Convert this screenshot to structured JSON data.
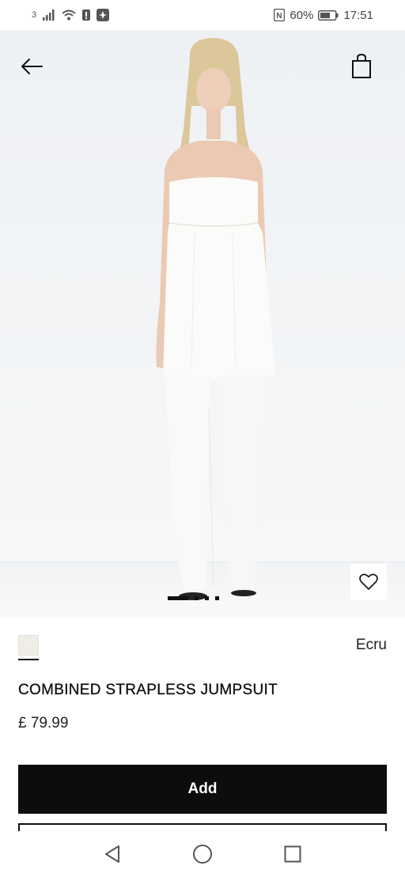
{
  "status_bar": {
    "sim_indicator": "3",
    "nfc_label": "N",
    "battery_percent": "60%",
    "time": "17:51"
  },
  "icons": {
    "back": "arrow-left-icon",
    "bag": "shopping-bag-icon",
    "favorite": "heart-icon",
    "nav_back": "triangle-back-icon",
    "nav_home": "circle-home-icon",
    "nav_recent": "square-recent-icon"
  },
  "gallery": {
    "image_count": 5,
    "active_index": 0
  },
  "product": {
    "color_name": "Ecru",
    "swatch_color": "#efede6",
    "title": "COMBINED STRAPLESS JUMPSUIT",
    "price": "£ 79.99"
  },
  "actions": {
    "add_label": "Add"
  },
  "colors": {
    "primary_button": "#0d0d0d",
    "primary_button_text": "#ffffff",
    "background": "#ffffff"
  }
}
